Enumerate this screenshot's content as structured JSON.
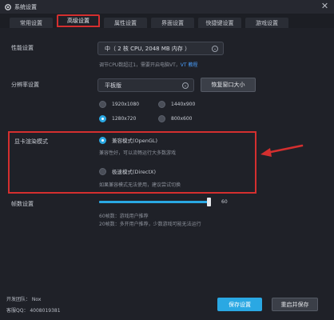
{
  "window": {
    "title": "系统设置",
    "close_glyph": "✕"
  },
  "tabs": [
    {
      "label": "常用设置",
      "active": false
    },
    {
      "label": "高级设置",
      "active": true
    },
    {
      "label": "属性设置",
      "active": false
    },
    {
      "label": "界面设置",
      "active": false
    },
    {
      "label": "快捷键设置",
      "active": false
    },
    {
      "label": "游戏设置",
      "active": false
    }
  ],
  "performance": {
    "label": "性能设置",
    "value": "中（ 2 核 CPU, 2048 MB 内存 ）",
    "hint_prefix": "调节CPU数超过1，需要开启电脑VT，",
    "hint_link": "VT 教程"
  },
  "resolution": {
    "label": "分辨率设置",
    "value": "平板版",
    "reset_button": "恢复窗口大小",
    "options": [
      {
        "label": "1920x1080",
        "selected": false
      },
      {
        "label": "1440x900",
        "selected": false
      },
      {
        "label": "1280x720",
        "selected": true
      },
      {
        "label": "800x600",
        "selected": false
      }
    ]
  },
  "render": {
    "label": "显卡渲染模式",
    "options": [
      {
        "label": "兼容模式(OpenGL)",
        "selected": true,
        "desc": "兼容性好，可以流畅运行大多数游戏"
      },
      {
        "label": "极速模式(DirectX)",
        "selected": false,
        "desc": "如果兼容模式无法使用，建议尝试切换"
      }
    ]
  },
  "fps": {
    "label": "帧数设置",
    "value": "60",
    "max": 60,
    "hints": [
      "60帧数：游戏用户推荐",
      "20帧数：多开用户推荐，少数游戏可能无法运行"
    ]
  },
  "footer": {
    "dev_team": "开发团队： Nox",
    "service": "客服QQ：  4008019381",
    "save_button": "保存设置",
    "restart_button": "重启并保存"
  },
  "colors": {
    "accent": "#2aa8e3",
    "highlight_red": "#d42f2f",
    "background": "#1f2128"
  },
  "icons": {
    "window": "gear-icon",
    "close": "close-icon",
    "dropdown": "chevron-down-icon"
  }
}
